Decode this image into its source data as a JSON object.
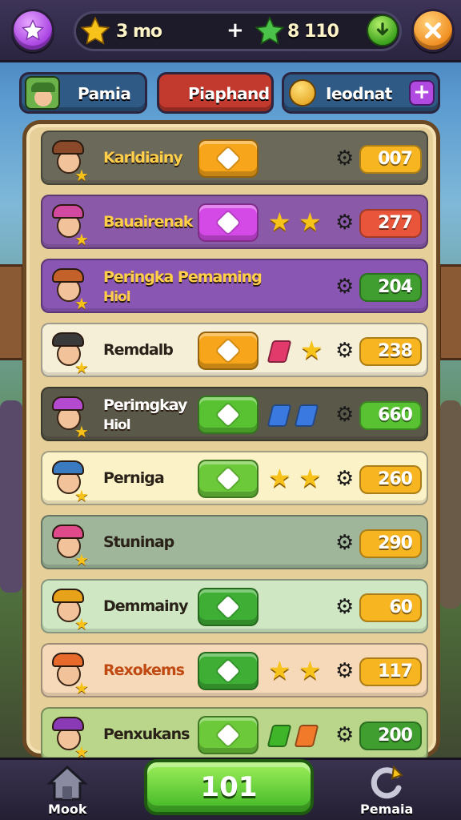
{
  "top": {
    "star_button_icon": "star-icon",
    "currency1_icon": "gold-star-icon",
    "currency1_value": "3 mo",
    "plus": "+",
    "currency2_icon": "green-star-icon",
    "currency2_value": "8 110",
    "download_icon": "download-arrow-icon",
    "close_icon": "close-x-icon"
  },
  "tabs": [
    {
      "label": "Pamia",
      "color": "#2f5a86"
    },
    {
      "label": "Piaphand",
      "color": "#c23a2e"
    },
    {
      "label": "Ieodnat",
      "color": "#2f5a86"
    }
  ],
  "rows": [
    {
      "name": "Karldiainy",
      "score": "007",
      "bg": "#6b6a5a",
      "name_color": "#ffcf4a",
      "button_color": "#f7a51a",
      "score_color": "#f6b521",
      "stars": 0,
      "gems": []
    },
    {
      "name": "Bauairenak",
      "score": "277",
      "bg": "#8a5aa8",
      "name_color": "#ffcf4a",
      "button_color": "#d44ae6",
      "score_color": "#e8553a",
      "stars": 2,
      "gems": []
    },
    {
      "name": "Peringka Pemaming",
      "name2": "Hiol",
      "score": "204",
      "bg": "#8a56b4",
      "name_color": "#ffcf4a",
      "button_color": "",
      "score_color": "#3f9e2f",
      "stars": 0,
      "gems": []
    },
    {
      "name": "Remdalb",
      "score": "238",
      "bg": "#f6efd8",
      "name_color": "#2a2218",
      "button_color": "#f7a51a",
      "score_color": "#f6b521",
      "stars": 1,
      "gems": [
        "#e23a6a"
      ]
    },
    {
      "name": "Perimgkay",
      "name2": "Hiol",
      "score": "660",
      "bg": "#5a5848",
      "name_color": "#ffffff",
      "button_color": "#58c232",
      "score_color": "#58c232",
      "stars": 0,
      "gems": [
        "#3a7ae0",
        "#3a7ae0"
      ]
    },
    {
      "name": "Perniga",
      "score": "260",
      "bg": "#fbf2c8",
      "name_color": "#2a2218",
      "button_color": "#6bc93a",
      "score_color": "#f6b521",
      "stars": 2,
      "gems": []
    },
    {
      "name": "Stuninap",
      "score": "290",
      "bg": "#9fb69a",
      "name_color": "#2a2218",
      "button_color": "",
      "score_color": "#f6b521",
      "stars": 0,
      "gems": []
    },
    {
      "name": "Demmainy",
      "score": "60",
      "bg": "#cfe7c2",
      "name_color": "#2a2218",
      "button_color": "#3eaf34",
      "score_color": "#f6b521",
      "stars": 0,
      "gems": []
    },
    {
      "name": "Rexokems",
      "score": "117",
      "bg": "#f6d9b8",
      "name_color": "#c04a12",
      "button_color": "#3eaf34",
      "score_color": "#f6b521",
      "stars": 2,
      "gems": []
    },
    {
      "name": "Penxukans",
      "score": "200",
      "bg": "#b9d68a",
      "name_color": "#2a2218",
      "button_color": "#6bc93a",
      "score_color": "#3f9e2f",
      "stars": 0,
      "gems": [
        "#3fb52a",
        "#f07a2a"
      ]
    }
  ],
  "bottom": {
    "left_label": "Mook",
    "left_icon": "house-icon",
    "center_label": "101",
    "right_label": "Pemaia",
    "right_icon": "refresh-icon"
  }
}
